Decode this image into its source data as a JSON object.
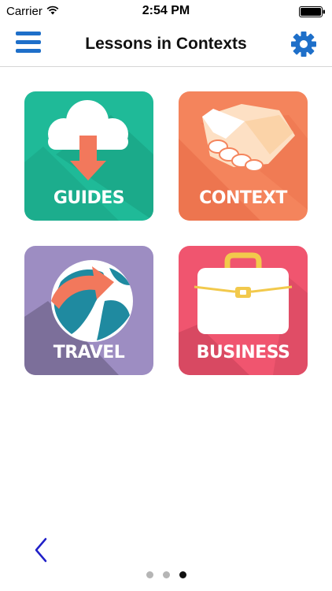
{
  "status_bar": {
    "carrier": "Carrier",
    "time": "2:54 PM",
    "icons": [
      "wifi-icon",
      "battery-icon"
    ]
  },
  "nav_bar": {
    "title": "Lessons in Contexts",
    "left_icon": "menu-icon",
    "right_icon": "gear-icon",
    "accent_color": "#1e6fc9"
  },
  "tiles": [
    {
      "label": "GUIDES",
      "icon": "cloud-download-icon",
      "color": "#1fba98"
    },
    {
      "label": "CONTEXT",
      "icon": "handshake-icon",
      "color": "#f4845c"
    },
    {
      "label": "TRAVEL",
      "icon": "globe-arrow-icon",
      "color": "#9d8dc2"
    },
    {
      "label": "BUSINESS",
      "icon": "briefcase-icon",
      "color": "#f0556f"
    }
  ],
  "footer": {
    "back_icon": "chevron-left-icon",
    "page_count": 3,
    "current_page": 3
  }
}
